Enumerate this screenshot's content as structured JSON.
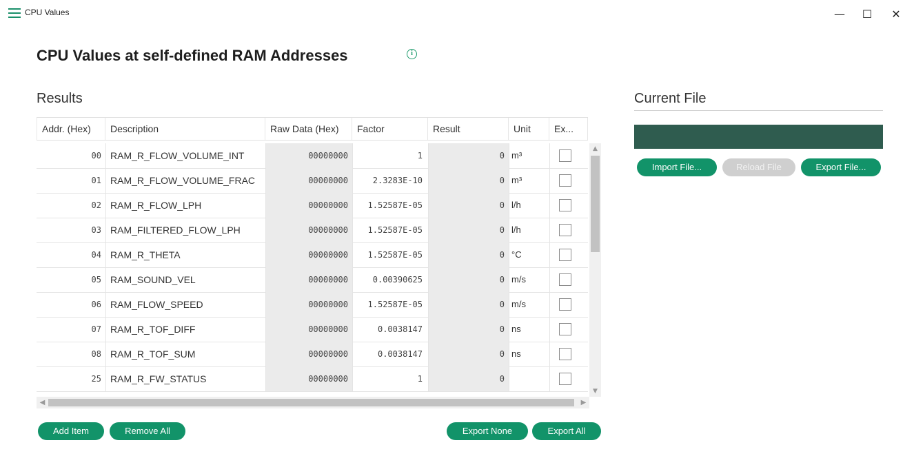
{
  "window": {
    "title": "CPU Values",
    "minimize_glyph": "—",
    "maximize_glyph": "☐",
    "close_glyph": "✕"
  },
  "page": {
    "title": "CPU Values at self-defined RAM Addresses",
    "info_glyph": "i"
  },
  "results": {
    "title": "Results",
    "columns": [
      "Addr. (Hex)",
      "Description",
      "Raw Data (Hex)",
      "Factor",
      "Result",
      "Unit",
      "Ex..."
    ],
    "rows": [
      {
        "addr": "00",
        "desc": "RAM_R_FLOW_VOLUME_INT",
        "raw": "00000000",
        "factor": "1",
        "result": "0",
        "unit": "m³",
        "export": false
      },
      {
        "addr": "01",
        "desc": "RAM_R_FLOW_VOLUME_FRAC",
        "raw": "00000000",
        "factor": "2.3283E-10",
        "result": "0",
        "unit": "m³",
        "export": false
      },
      {
        "addr": "02",
        "desc": "RAM_R_FLOW_LPH",
        "raw": "00000000",
        "factor": "1.52587E-05",
        "result": "0",
        "unit": "l/h",
        "export": false
      },
      {
        "addr": "03",
        "desc": "RAM_FILTERED_FLOW_LPH",
        "raw": "00000000",
        "factor": "1.52587E-05",
        "result": "0",
        "unit": "l/h",
        "export": false
      },
      {
        "addr": "04",
        "desc": "RAM_R_THETA",
        "raw": "00000000",
        "factor": "1.52587E-05",
        "result": "0",
        "unit": "°C",
        "export": false
      },
      {
        "addr": "05",
        "desc": "RAM_SOUND_VEL",
        "raw": "00000000",
        "factor": "0.00390625",
        "result": "0",
        "unit": "m/s",
        "export": false
      },
      {
        "addr": "06",
        "desc": "RAM_FLOW_SPEED",
        "raw": "00000000",
        "factor": "1.52587E-05",
        "result": "0",
        "unit": "m/s",
        "export": false
      },
      {
        "addr": "07",
        "desc": "RAM_R_TOF_DIFF",
        "raw": "00000000",
        "factor": "0.0038147",
        "result": "0",
        "unit": "ns",
        "export": false
      },
      {
        "addr": "08",
        "desc": "RAM_R_TOF_SUM",
        "raw": "00000000",
        "factor": "0.0038147",
        "result": "0",
        "unit": "ns",
        "export": false
      },
      {
        "addr": "25",
        "desc": "RAM_R_FW_STATUS",
        "raw": "00000000",
        "factor": "1",
        "result": "0",
        "unit": "",
        "export": false
      }
    ],
    "buttons": {
      "add_item": "Add Item",
      "remove_all": "Remove All",
      "export_none": "Export None",
      "export_all": "Export All"
    }
  },
  "current_file": {
    "title": "Current File",
    "path": "",
    "buttons": {
      "import": "Import File...",
      "reload": "Reload File",
      "export": "Export File..."
    }
  },
  "colors": {
    "accent": "#129369",
    "file_bar": "#2f5c4f",
    "disabled": "#cfcfcf"
  }
}
